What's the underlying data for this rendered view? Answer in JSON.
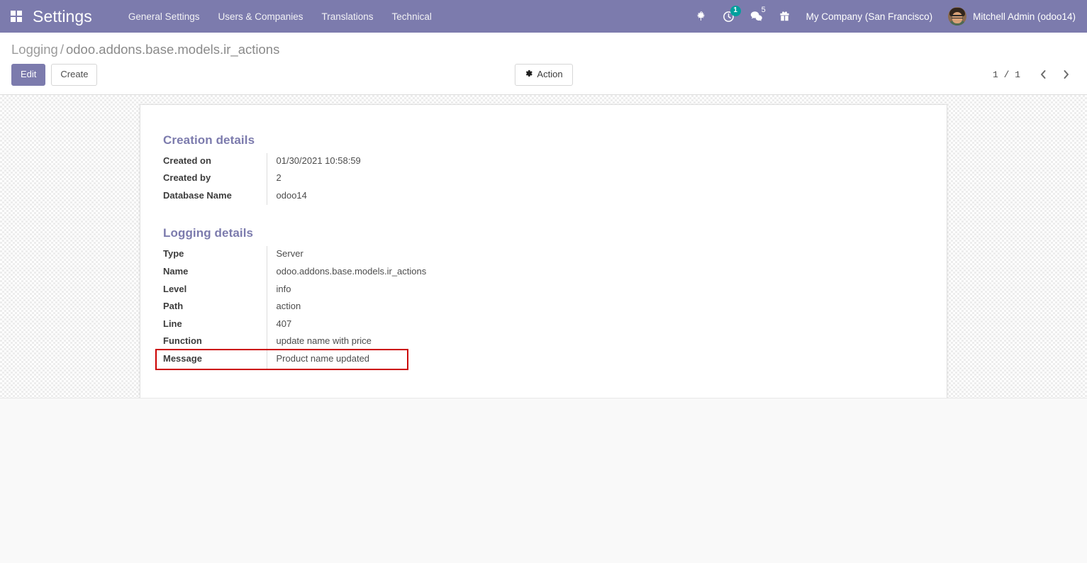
{
  "navbar": {
    "apps_icon": "apps-grid-icon",
    "app_name": "Settings",
    "menu_items": [
      {
        "label": "General Settings"
      },
      {
        "label": "Users & Companies"
      },
      {
        "label": "Translations"
      },
      {
        "label": "Technical"
      }
    ],
    "system_icons": [
      {
        "name": "bug-icon",
        "badge": ""
      },
      {
        "name": "activity-clock-icon",
        "badge": "1"
      },
      {
        "name": "messages-chat-icon",
        "badge": "5"
      },
      {
        "name": "gift-icon",
        "badge": ""
      }
    ],
    "activity_count": "1",
    "messages_count": "5",
    "company": "My Company (San Francisco)",
    "username": "Mitchell Admin (odoo14)",
    "background_color": "#7c7bad"
  },
  "control_panel": {
    "breadcrumb_root": "Logging",
    "breadcrumb_separator": "/",
    "breadcrumb_current": "odoo.addons.base.models.ir_actions",
    "edit_label": "Edit",
    "create_label": "Create",
    "action_label": "Action",
    "action_icon": "gear-icon",
    "pager_value": "1 / 1",
    "pager_prev_icon": "chevron-left-icon",
    "pager_next_icon": "chevron-right-icon"
  },
  "form": {
    "creation_group": {
      "title": "Creation details",
      "fields": [
        {
          "label": "Created on",
          "value": "01/30/2021 10:58:59"
        },
        {
          "label": "Created by",
          "value": "2"
        },
        {
          "label": "Database Name",
          "value": "odoo14"
        }
      ]
    },
    "logging_group": {
      "title": "Logging details",
      "fields": [
        {
          "label": "Type",
          "value": "Server"
        },
        {
          "label": "Name",
          "value": "odoo.addons.base.models.ir_actions"
        },
        {
          "label": "Level",
          "value": "info"
        },
        {
          "label": "Path",
          "value": "action"
        },
        {
          "label": "Line",
          "value": "407"
        },
        {
          "label": "Function",
          "value": "update name with price"
        },
        {
          "label": "Message",
          "value": "Product name updated"
        }
      ]
    }
  },
  "annotation": {
    "highlight_color": "#cc0000",
    "highlight_target": "Message"
  }
}
